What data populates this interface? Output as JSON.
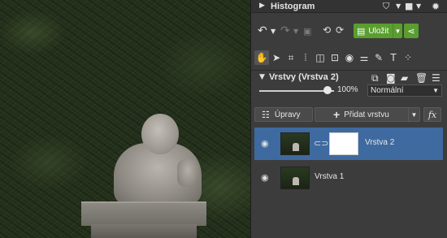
{
  "histogram": {
    "title": "Histogram",
    "icons": [
      "caret-right-icon",
      "cart-icon",
      "chevron-down-icon",
      "view-mode-icon",
      "chevron-down-icon",
      "settings-icon"
    ]
  },
  "toolbar": {
    "save_label": "Uložit",
    "accent_color": "#5a9e2f"
  },
  "tools": [
    "hand-tool-icon",
    "pointer-tool-icon",
    "crop-tool-icon",
    "straighten-tool-icon",
    "perspective-tool-icon",
    "adjust-tool-icon",
    "eye-tool-icon",
    "filter-tool-icon",
    "brush-tool-icon",
    "text-tool-icon",
    "more-tools-icon"
  ],
  "layers_panel": {
    "title": "Vrstvy (Vrstva 2)",
    "opacity": "100%",
    "opacity_value": 1.0,
    "blend_mode": "Normální",
    "edits_label": "Úpravy",
    "add_layer_label": "Přidat vrstvu",
    "fx_label": "fx",
    "layers": [
      {
        "name": "Vrstva 2",
        "selected": true,
        "has_mask": true
      },
      {
        "name": "Vrstva 1",
        "selected": false,
        "has_mask": false
      }
    ],
    "selected_color": "#3e6aa0"
  }
}
